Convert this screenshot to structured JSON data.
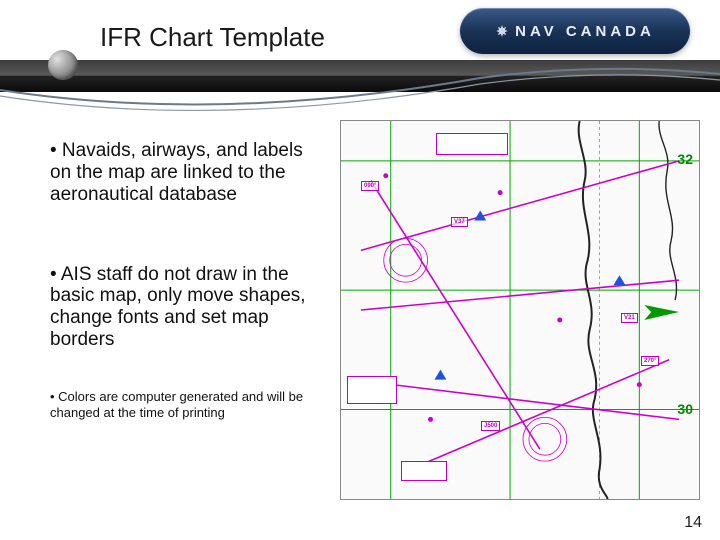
{
  "header": {
    "title": "IFR Chart Template",
    "logo_text": "NAV CANADA"
  },
  "bullets": {
    "b1": "• Navaids, airways, and labels on the map are linked to the aeronautical database",
    "b2": "• AIS staff do not draw in the basic map, only move shapes, change fonts and set map borders",
    "b3": "• Colors are computer generated and will be changed at the time of printing"
  },
  "page_number": "14",
  "chart": {
    "tick_top": "32",
    "tick_bottom": "30"
  }
}
